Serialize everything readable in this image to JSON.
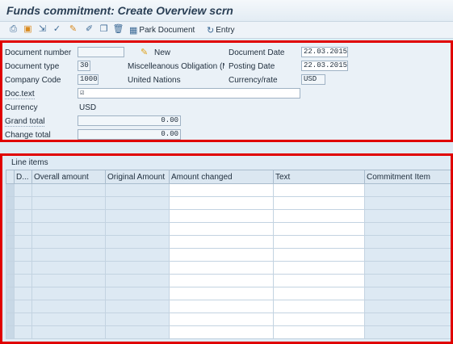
{
  "window": {
    "title": "Funds commitment: Create Overview scrn"
  },
  "toolbar": {
    "icons": [
      "print-icon",
      "save-icon",
      "export-icon",
      "check-icon",
      "edit-icon",
      "copy-icon",
      "delete-icon"
    ],
    "park_label": "Park Document",
    "entry_label": "Entry"
  },
  "header": {
    "document_number_label": "Document number",
    "document_number_value": "",
    "new_label": "New",
    "document_date_label": "Document Date",
    "document_date_value": "22.03.2015",
    "document_type_label": "Document type",
    "document_type_value": "30",
    "document_type_text": "Miscelleanous Obligation (M...",
    "posting_date_label": "Posting Date",
    "posting_date_value": "22.03.2015",
    "company_code_label": "Company Code",
    "company_code_value": "1000",
    "company_name": "United Nations",
    "currency_rate_label": "Currency/rate",
    "currency_rate_value": "USD",
    "doc_text_label": "Doc.text",
    "doc_text_value": "☑",
    "currency_label": "Currency",
    "currency_value": "USD",
    "grand_total_label": "Grand total",
    "grand_total_value": "0.00",
    "change_total_label": "Change total",
    "change_total_value": "0.00"
  },
  "line_items": {
    "title": "Line items",
    "columns": [
      "D...",
      "Overall amount",
      "Original Amount",
      "Amount changed",
      "Text",
      "Commitment Item"
    ]
  },
  "colors": {
    "highlight_frame": "#e00000",
    "background": "#dfebf5"
  }
}
